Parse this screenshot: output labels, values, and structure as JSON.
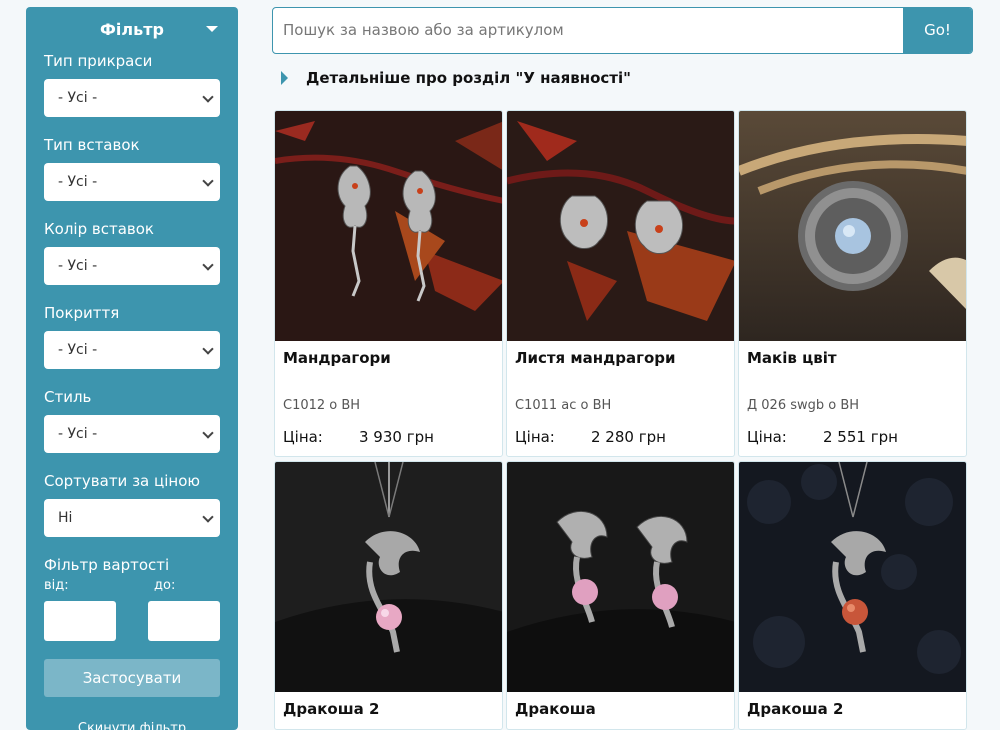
{
  "filter": {
    "title": "Фільтр",
    "groups": [
      {
        "label": "Тип прикраси",
        "value": "- Усі -"
      },
      {
        "label": "Тип вставок",
        "value": "- Усі -"
      },
      {
        "label": "Колір вставок",
        "value": "- Усі -"
      },
      {
        "label": "Покриття",
        "value": "- Усі -"
      },
      {
        "label": "Стиль",
        "value": "- Усі -"
      },
      {
        "label": "Сортувати за ціною",
        "value": "Ні"
      }
    ],
    "price_filter_label": "Фільтр вартості",
    "from_label": "від:",
    "to_label": "до:",
    "apply_label": "Застосувати",
    "reset_label": "Скинути фільтр"
  },
  "search": {
    "placeholder": "Пошук за назвою або за артикулом",
    "button": "Go!"
  },
  "section_link": "Детальніше про розділ \"У наявності\"",
  "price_label": "Ціна:",
  "products": [
    {
      "name": "Мандрагори",
      "sku": "С1012 о ВН",
      "price": "3 930 грн",
      "image": "earrings-leaves-figure"
    },
    {
      "name": "Листя мандрагори",
      "sku": "С1011 ас о ВН",
      "price": "2 280 грн",
      "image": "earrings-leaves-red-stone"
    },
    {
      "name": "Маків цвіт",
      "sku": "Д 026 swgb о ВН",
      "price": "2 551 грн",
      "image": "poppy-ring-blue-stone"
    },
    {
      "name": "Дракоша 2",
      "image": "dragon-pendant-pink-stone"
    },
    {
      "name": "Дракоша",
      "image": "dragon-earrings-pink-stones"
    },
    {
      "name": "Дракоша 2",
      "image": "dragon-pendant-orange-stone"
    }
  ]
}
